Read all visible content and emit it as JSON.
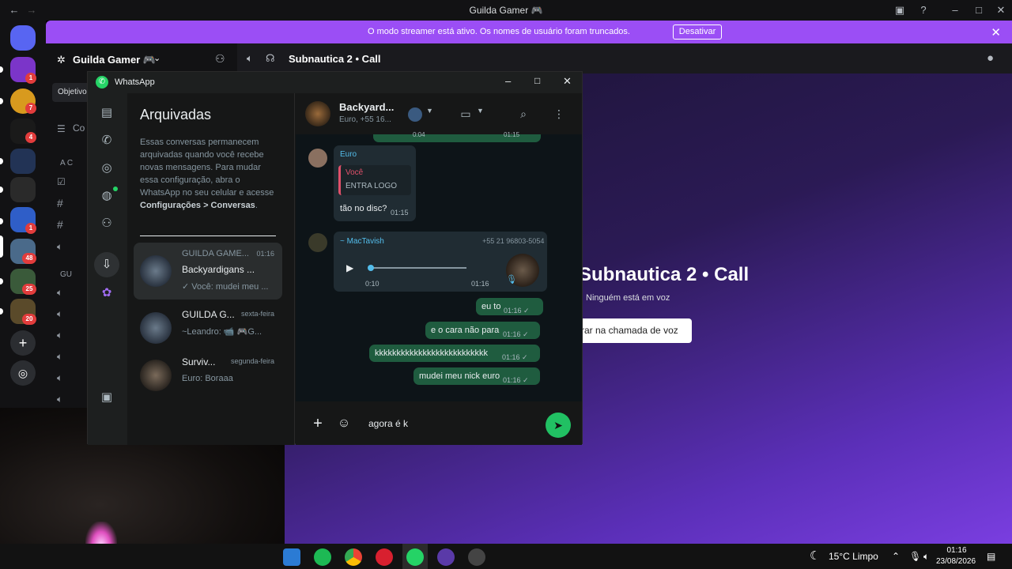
{
  "window": {
    "title": "Guilda Gamer 🎮"
  },
  "banner": {
    "message": "O modo streamer está ativo. Os nomes de usuário foram truncados.",
    "button": "Desativar"
  },
  "rail": {
    "badges": [
      "1",
      "7",
      "4",
      "1",
      "48",
      "25",
      "20"
    ]
  },
  "sidebar": {
    "guild_name": "Guilda Gamer 🎮",
    "objectives": "Objetivo",
    "channel_hint": "Co",
    "category_1": "A C",
    "category_2": "GU"
  },
  "call": {
    "channel": "Subnautica 2 • Call",
    "big_title": "Subnautica 2 • Call",
    "subtitle": "Ninguém está em voz",
    "join_button": "rar na chamada de voz"
  },
  "whatsapp": {
    "title": "WhatsApp",
    "archived_title": "Arquivadas",
    "archived_desc_prefix": "Essas conversas permanecem arquivadas quando você recebe novas mensagens. Para mudar essa configuração, abra o WhatsApp no seu celular e acesse ",
    "archived_desc_bold": "Configurações > Conversas",
    "archived_desc_suffix": ".",
    "chats": [
      {
        "group": "GUILDA GAME...",
        "name": "Backyardigans ...",
        "time": "01:16",
        "preview": "✓ Você: mudei meu ..."
      },
      {
        "name": "GUILDA G...",
        "time": "sexta-feira",
        "preview": "~Leandro: 📹 🎮G..."
      },
      {
        "name": "Surviv...",
        "time": "segunda-feira",
        "preview": "Euro: Boraaa"
      }
    ],
    "conversation": {
      "name": "Backyard...",
      "sub": "Euro, +55 16...",
      "top_time": "01:15",
      "top_duration": "0:04",
      "messages": [
        {
          "sender": "Euro",
          "quote_author": "Você",
          "quote_text": "ENTRA LOGO",
          "text": "tão no disc?",
          "time": "01:15"
        },
        {
          "sender": "~ MacTavish",
          "phone": "+55 21 96803-5054",
          "audio_duration": "0:10",
          "time": "01:16"
        },
        {
          "text": "eu to",
          "time": "01:16 ✓"
        },
        {
          "text": "e o cara não para",
          "time": "01:16 ✓"
        },
        {
          "text": "kkkkkkkkkkkkkkkkkkkkkkkkkk",
          "time": "01:16 ✓"
        },
        {
          "text": "mudei meu nick euro",
          "time": "01:16 ✓"
        }
      ],
      "composer_value": "agora é k"
    }
  },
  "taskbar": {
    "weather": "15°C  Limpo",
    "time": "01:16",
    "date": "23/08/2026"
  }
}
